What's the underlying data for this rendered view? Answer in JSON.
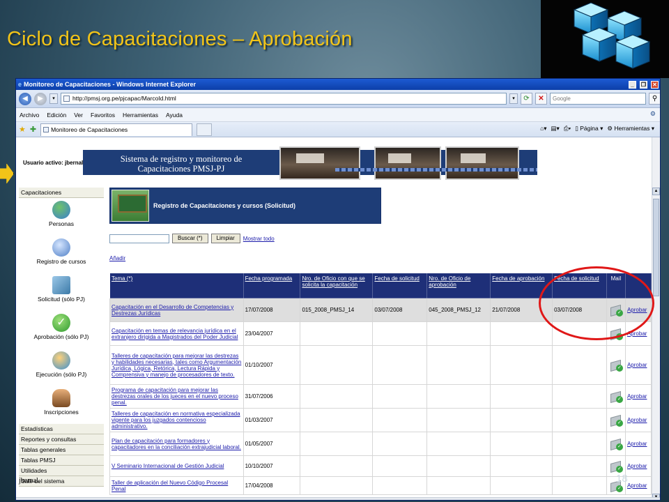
{
  "slide": {
    "title": "Ciclo de Capacitaciones – Aprobación",
    "page_number": "18",
    "accent_color": "#f2c418"
  },
  "browser": {
    "window_title": "Monitoreo de Capacitaciones - Windows Internet Explorer",
    "url": "http://pmsj.org.pe/pjcapac/MarcoId.html",
    "search_placeholder": "Google",
    "menu": [
      "Archivo",
      "Edición",
      "Ver",
      "Favoritos",
      "Herramientas",
      "Ayuda"
    ],
    "tab_title": "Monitoreo de Capacitaciones",
    "commands": [
      "Página",
      "Herramientas"
    ]
  },
  "header": {
    "user_label": "Usuario activo: jbernal",
    "system_title": "Sistema de registro y monitoreo de Capacitaciones PMSJ-PJ"
  },
  "sidebar": {
    "sections_top": [
      "Capacitaciones"
    ],
    "subitems": [
      {
        "label": "Personas",
        "icon": "people-icon"
      },
      {
        "label": "Registro de cursos",
        "icon": "globe-icon"
      },
      {
        "label": "Solicitud (sólo PJ)",
        "icon": "book-icon"
      },
      {
        "label": "Aprobación (sólo PJ)",
        "icon": "check-icon"
      },
      {
        "label": "Ejecución (sólo PJ)",
        "icon": "gears-icon"
      },
      {
        "label": "Inscripciones",
        "icon": "person-icon"
      }
    ],
    "sections_bottom": [
      "Estadísticas",
      "Reportes y consultas",
      "Tablas generales",
      "Tablas PMSJ",
      "Utilidades",
      "Salir del sistema"
    ]
  },
  "content": {
    "banner_title": "Registro de Capacitaciones y cursos (Solicitud)",
    "search_button": "Buscar (*)",
    "clear_button": "Limpiar",
    "show_all": "Mostrar todo",
    "add_link": "Añadir",
    "columns": [
      "Tema (*)",
      "Fecha programada",
      "Nro. de Oficio con que se solicita la capacitación",
      "Fecha de solicitud",
      "Nro. de Oficio de aprobación",
      "Fecha de aprobación",
      "Fecha de solicitud",
      "Mail",
      ""
    ],
    "rows": [
      {
        "tema": "Capacitación en el Desarrollo de Competencias y Destrezas Jurídicas",
        "fecha_prog": "17/07/2008",
        "oficio_sol": "015_2008_PMSJ_14",
        "fecha_sol": "03/07/2008",
        "oficio_apr": "045_2008_PMSJ_12",
        "fecha_apr": "21/07/2008",
        "fecha_sol2": "03/07/2008",
        "accion": "Aprobar"
      },
      {
        "tema": "Capacitación en temas de relevancia jurídica en el extranjero dirigida a Magistrados del Poder Judicial",
        "fecha_prog": "23/04/2007",
        "oficio_sol": "",
        "fecha_sol": "",
        "oficio_apr": "",
        "fecha_apr": "",
        "fecha_sol2": "",
        "accion": "Aprobar"
      },
      {
        "tema": "Talleres de capacitación para mejorar las destrezas y habilidades necesarias, tales como Argumentación Jurídica, Lógica, Retórica, Lectura Rápida y Comprensiva y manejo de procesadores de texto.",
        "fecha_prog": "01/10/2007",
        "oficio_sol": "",
        "fecha_sol": "",
        "oficio_apr": "",
        "fecha_apr": "",
        "fecha_sol2": "",
        "accion": "Aprobar"
      },
      {
        "tema": "Programa de capacitación para mejorar las destrezas orales de los jueces en el nuevo proceso penal.",
        "fecha_prog": "31/07/2006",
        "oficio_sol": "",
        "fecha_sol": "",
        "oficio_apr": "",
        "fecha_apr": "",
        "fecha_sol2": "",
        "accion": "Aprobar"
      },
      {
        "tema": "Talleres de capacitación en normativa especializada vigente para los juzgados contencioso administrativo.",
        "fecha_prog": "01/03/2007",
        "oficio_sol": "",
        "fecha_sol": "",
        "oficio_apr": "",
        "fecha_apr": "",
        "fecha_sol2": "",
        "accion": "Aprobar"
      },
      {
        "tema": "Plan de capacitación para formadores y capacitadores en la conciliación extrajudicial laboral.",
        "fecha_prog": "01/05/2007",
        "oficio_sol": "",
        "fecha_sol": "",
        "oficio_apr": "",
        "fecha_apr": "",
        "fecha_sol2": "",
        "accion": "Aprobar"
      },
      {
        "tema": "V Seminario Internacional de Gestión Judicial",
        "fecha_prog": "10/10/2007",
        "oficio_sol": "",
        "fecha_sol": "",
        "oficio_apr": "",
        "fecha_apr": "",
        "fecha_sol2": "",
        "accion": "Aprobar"
      },
      {
        "tema": "Taller de aplicación del Nuevo Código Procesal Penal",
        "fecha_prog": "17/04/2008",
        "oficio_sol": "",
        "fecha_sol": "",
        "oficio_apr": "",
        "fecha_apr": "",
        "fecha_sol2": "",
        "accion": "Aprobar"
      }
    ]
  },
  "footer": {
    "user": "jbernal."
  }
}
